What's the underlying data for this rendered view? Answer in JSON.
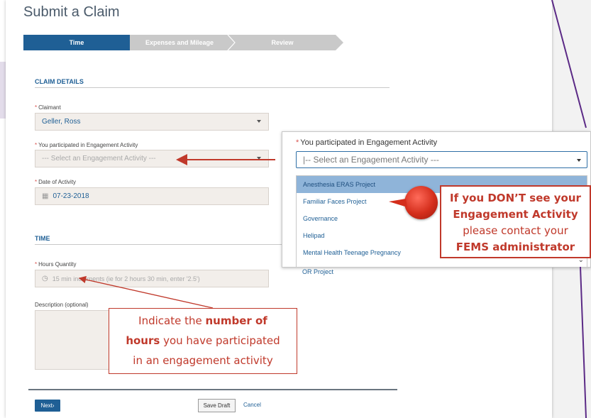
{
  "page": {
    "title": "Submit a Claim"
  },
  "wizard": {
    "steps": [
      {
        "label": "Time"
      },
      {
        "label": "Expenses and Mileage"
      },
      {
        "label": "Review"
      }
    ]
  },
  "claim_details": {
    "section_title": "CLAIM DETAILS",
    "claimant": {
      "label": "Claimant",
      "value": "Geller, Ross"
    },
    "engagement": {
      "label": "You participated in Engagement Activity",
      "placeholder": "--- Select an Engagement Activity ---"
    },
    "date": {
      "label": "Date of Activity",
      "value": "07-23-2018"
    }
  },
  "time": {
    "section_title": "TIME",
    "hours": {
      "label": "Hours Quantity",
      "placeholder": "15 min increments (ie for 2 hours 30 min, enter '2.5')"
    },
    "description": {
      "label": "Description (optional)"
    }
  },
  "footer": {
    "next_label": "Next›",
    "save_label": "Save Draft",
    "cancel_label": "Cancel"
  },
  "zoom_panel": {
    "label": "You participated in Engagement Activity",
    "placeholder": "|-- Select an Engagement Activity ---",
    "options": [
      "Anesthesia ERAS Project",
      "Familiar Faces Project",
      "Governance",
      "Helipad",
      "Mental Health Teenage Pregnancy",
      "OR Project"
    ]
  },
  "callouts": {
    "right": {
      "line1": "If you DON’T see your",
      "line2": "Engagement Activity",
      "line3": "please contact your",
      "line4": "FEMS administrator"
    },
    "hours": {
      "line1_pre": "Indicate the ",
      "line1_bold": "number of",
      "line2_bold": "hours",
      "line2_post": " you have participated",
      "line3": "in an engagement activity"
    }
  },
  "colors": {
    "accent": "#1f5f95",
    "callout": "#c0392b",
    "band": "#e3dcea",
    "decor_line": "#5b2a86"
  }
}
